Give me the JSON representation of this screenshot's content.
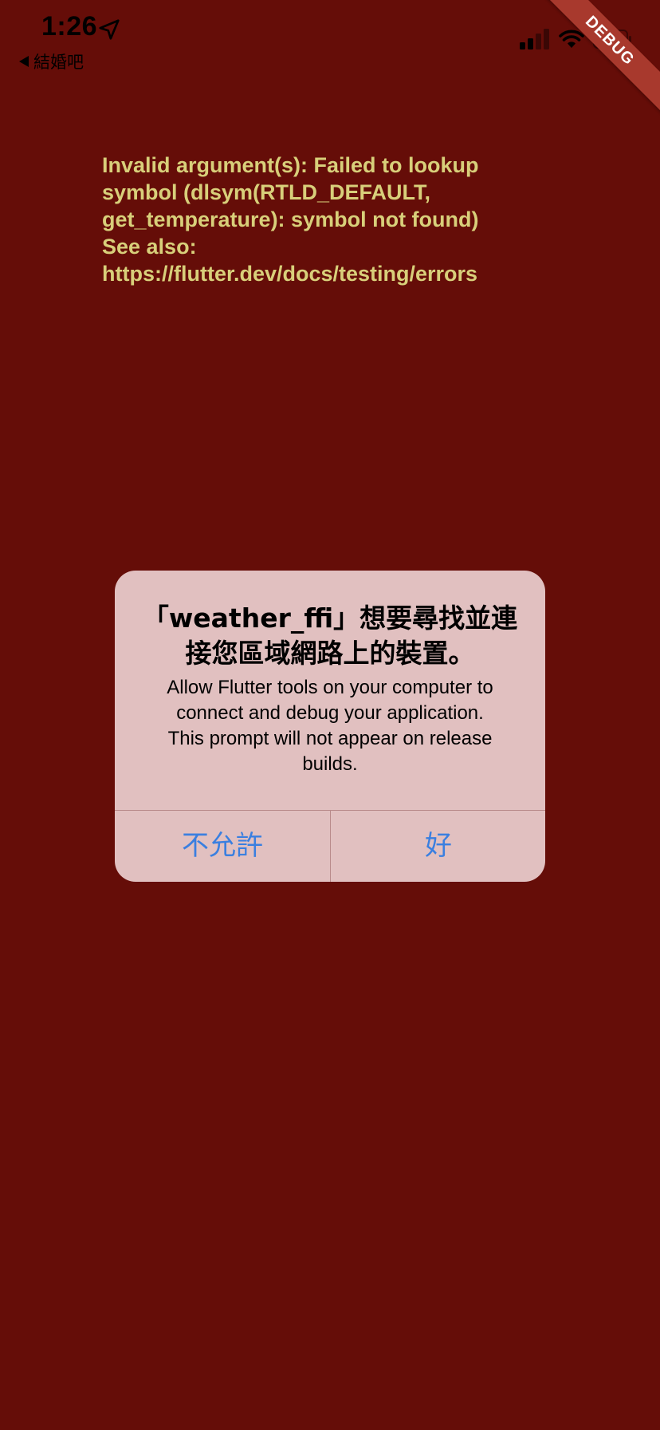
{
  "status_bar": {
    "time": "1:26",
    "back_label": "結婚吧",
    "icons": [
      "location-arrow-icon",
      "signal-icon",
      "wifi-icon",
      "battery-icon"
    ]
  },
  "debug_banner": "DEBUG",
  "error": {
    "lines": [
      "Invalid argument(s): Failed to lookup",
      "symbol (dlsym(RTLD_DEFAULT,",
      "get_temperature): symbol not found)",
      "See also:",
      "https://flutter.dev/docs/testing/errors"
    ]
  },
  "alert": {
    "title_lines": [
      "「weather_ffi」想要尋找並連",
      "接您區域網路上的裝置。"
    ],
    "message_lines": [
      "Allow Flutter tools on your computer to",
      "connect and debug your application.",
      "This prompt will not appear on release",
      "builds."
    ],
    "deny_label": "不允許",
    "allow_label": "好"
  },
  "colors": {
    "background": "#650d08",
    "error_text": "#d8cf7a",
    "alert_bg": "#e1c0c0",
    "alert_button": "#3a7fe0",
    "debug_banner": "#a8392d"
  }
}
